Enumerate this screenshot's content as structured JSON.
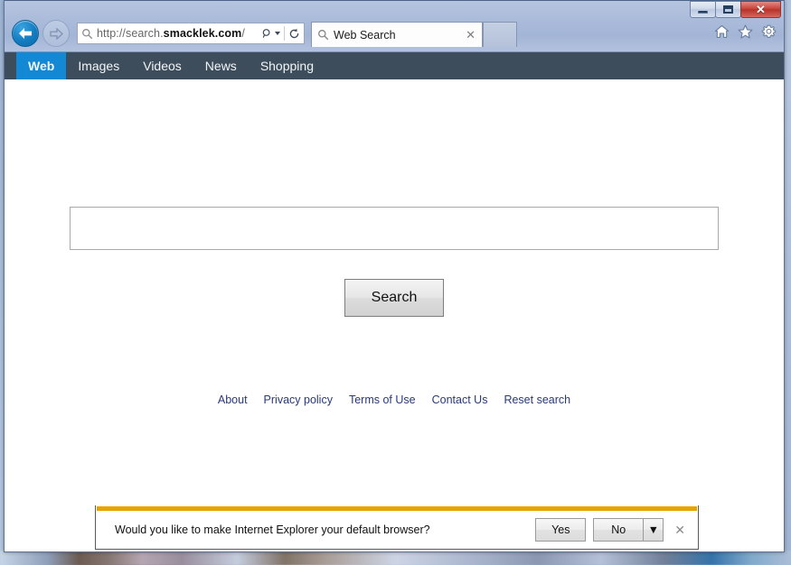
{
  "window": {
    "controls": {
      "minimize_label": "Minimize",
      "maximize_label": "Restore",
      "close_label": "✕"
    }
  },
  "browser": {
    "back_label": "Back",
    "forward_label": "Forward",
    "address": {
      "scheme": "http://",
      "subdomain": "search.",
      "domain": "smacklek.com",
      "path": "/",
      "full_url": "http://search.smacklek.com/"
    },
    "tab": {
      "title": "Web Search",
      "close_label": "✕"
    },
    "newtab_label": "New tab",
    "toolbar": {
      "home_label": "Home",
      "favorites_label": "Favorites",
      "tools_label": "Tools"
    }
  },
  "sitenav": {
    "items": [
      {
        "label": "Web",
        "active": true
      },
      {
        "label": "Images",
        "active": false
      },
      {
        "label": "Videos",
        "active": false
      },
      {
        "label": "News",
        "active": false
      },
      {
        "label": "Shopping",
        "active": false
      }
    ]
  },
  "search": {
    "value": "",
    "placeholder": "",
    "button_label": "Search"
  },
  "footer": {
    "links": [
      {
        "label": "About"
      },
      {
        "label": "Privacy policy"
      },
      {
        "label": "Terms of Use"
      },
      {
        "label": "Contact Us"
      },
      {
        "label": "Reset search"
      }
    ]
  },
  "notification": {
    "message": "Would you like to make Internet Explorer your default browser?",
    "yes_label": "Yes",
    "no_label": "No",
    "dropdown_label": "▼",
    "close_label": "✕"
  },
  "colors": {
    "titlebar": "#aabbda",
    "sitenav_bg": "#3e4d5c",
    "sitenav_active": "#1388d4",
    "link": "#29397a",
    "notify_stripe": "#e8a302",
    "close_button": "#c9443b"
  }
}
